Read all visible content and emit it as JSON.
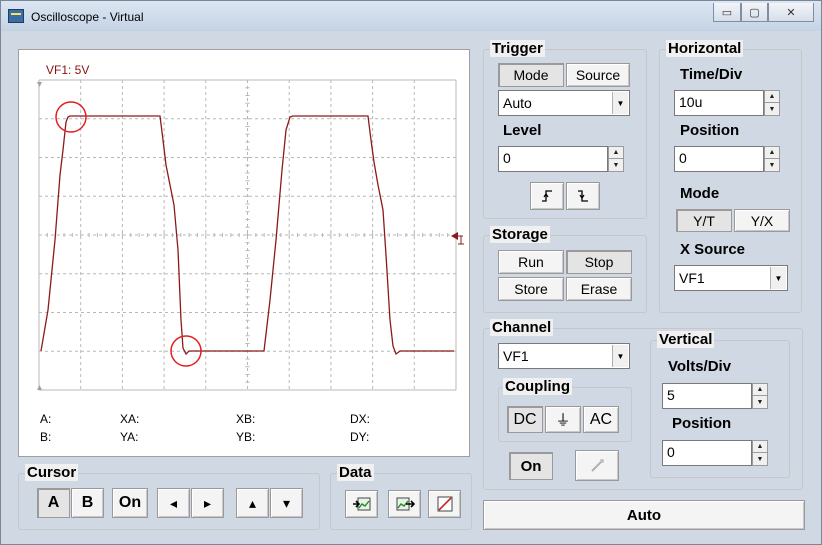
{
  "window": {
    "title": "Oscilloscope - Virtual"
  },
  "title_buttons": {
    "minimize": "▭",
    "maximize": "▢",
    "close": "✕"
  },
  "colors": {
    "trace": "#8b1a1a",
    "marker": "#e02020",
    "grid": "#b8b8b8",
    "accent": "#3a6ea5"
  },
  "scope": {
    "channel_label": "VF1: 5V",
    "readouts": {
      "a": "A:",
      "b": "B:",
      "xa": "XA:",
      "ya": "YA:",
      "xb": "XB:",
      "yb": "YB:",
      "dx": "DX:",
      "dy": "DY:"
    }
  },
  "trigger": {
    "title": "Trigger",
    "mode_label": "Mode",
    "source_label": "Source",
    "mode_select": "Auto",
    "level_label": "Level",
    "level_value": "0",
    "rising_icon": "rising-edge-icon",
    "falling_icon": "falling-edge-icon"
  },
  "horizontal": {
    "title": "Horizontal",
    "time_div_label": "Time/Div",
    "time_div_value": "10u",
    "position_label": "Position",
    "position_value": "0",
    "mode_label": "Mode",
    "yt_label": "Y/T",
    "yx_label": "Y/X",
    "x_source_label": "X Source",
    "x_source_value": "VF1"
  },
  "storage": {
    "title": "Storage",
    "run_label": "Run",
    "stop_label": "Stop",
    "store_label": "Store",
    "erase_label": "Erase"
  },
  "channel": {
    "title": "Channel",
    "select_value": "VF1",
    "coupling_title": "Coupling",
    "dc_label": "DC",
    "gnd_label": "⏚",
    "ac_label": "AC",
    "on_label": "On"
  },
  "vertical": {
    "title": "Vertical",
    "volts_div_label": "Volts/Div",
    "volts_div_value": "5",
    "position_label": "Position",
    "position_value": "0"
  },
  "cursor": {
    "title": "Cursor",
    "a_label": "A",
    "b_label": "B",
    "on_label": "On",
    "left_icon": "◂",
    "right_icon": "▸",
    "up_icon": "▴",
    "down_icon": "▾"
  },
  "data_group": {
    "title": "Data"
  },
  "auto_button": {
    "label": "Auto"
  }
}
